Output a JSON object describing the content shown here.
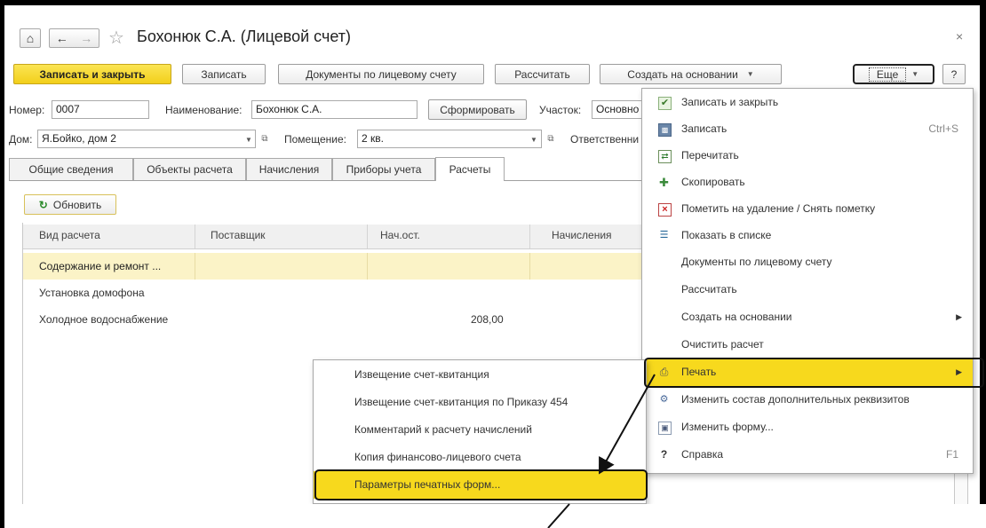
{
  "window": {
    "title": "Бохонюк С.А. (Лицевой счет)",
    "home_icon": "home-icon",
    "back_icon": "back-arrow-icon",
    "forward_icon": "forward-arrow-icon",
    "star_icon": "star-icon",
    "close_glyph": "×"
  },
  "toolbar": {
    "save_close": "Записать и закрыть",
    "save": "Записать",
    "docs": "Документы по лицевому счету",
    "calc": "Рассчитать",
    "create_based": "Создать на основании",
    "more": "Еще",
    "help": "?"
  },
  "form": {
    "number_label": "Номер:",
    "number_value": "0007",
    "name_label": "Наименование:",
    "name_value": "Бохонюк С.А.",
    "generate_btn": "Сформировать",
    "site_label": "Участок:",
    "site_value": "Основно",
    "house_label": "Дом:",
    "house_value": "Я.Бойко, дом 2",
    "room_label": "Помещение:",
    "room_value": "2 кв.",
    "responsible_label": "Ответственни"
  },
  "tabs": [
    "Общие сведения",
    "Объекты расчета",
    "Начисления",
    "Приборы учета",
    "Расчеты"
  ],
  "refresh_btn": "Обновить",
  "table": {
    "headers": [
      "Вид расчета",
      "Поставщик",
      "Нач.ост.",
      "Начисления"
    ],
    "rows": [
      {
        "kind": "Содержание и ремонт ...",
        "supplier": "",
        "start": "",
        "accrual": ""
      },
      {
        "kind": "Установка домофона",
        "supplier": "",
        "start": "",
        "accrual": ""
      },
      {
        "kind": "Холодное водоснабжение",
        "supplier": "",
        "start": "208,00",
        "accrual": ""
      }
    ]
  },
  "menu": {
    "items": [
      {
        "label": "Записать и закрыть",
        "icon": "save-close-icon",
        "shortcut": ""
      },
      {
        "label": "Записать",
        "icon": "save-icon",
        "shortcut": "Ctrl+S"
      },
      {
        "label": "Перечитать",
        "icon": "reread-icon",
        "shortcut": ""
      },
      {
        "label": "Скопировать",
        "icon": "copy-icon",
        "shortcut": ""
      },
      {
        "label": "Пометить на удаление / Снять пометку",
        "icon": "delete-mark-icon",
        "shortcut": ""
      },
      {
        "label": "Показать в списке",
        "icon": "show-in-list-icon",
        "shortcut": ""
      },
      {
        "label": "Документы по лицевому счету",
        "icon": "",
        "shortcut": ""
      },
      {
        "label": "Рассчитать",
        "icon": "",
        "shortcut": ""
      },
      {
        "label": "Создать на основании",
        "icon": "",
        "shortcut": ""
      },
      {
        "label": "Очистить расчет",
        "icon": "",
        "shortcut": ""
      },
      {
        "label": "Печать",
        "icon": "print-icon",
        "shortcut": ""
      },
      {
        "label": "Изменить состав дополнительных реквизитов",
        "icon": "attributes-icon",
        "shortcut": ""
      },
      {
        "label": "Изменить форму...",
        "icon": "change-form-icon",
        "shortcut": ""
      },
      {
        "label": "Справка",
        "icon": "help-icon",
        "shortcut": "F1"
      }
    ]
  },
  "print_submenu": {
    "items": [
      "Извещение счет-квитанция",
      "Извещение счет-квитанция по Приказу 454",
      "Комментарий к расчету начислений",
      "Копия финансово-лицевого счета",
      "Параметры печатных форм..."
    ]
  },
  "colors": {
    "accent_yellow": "#f7d91d",
    "selected_row": "#fbf3c7"
  }
}
